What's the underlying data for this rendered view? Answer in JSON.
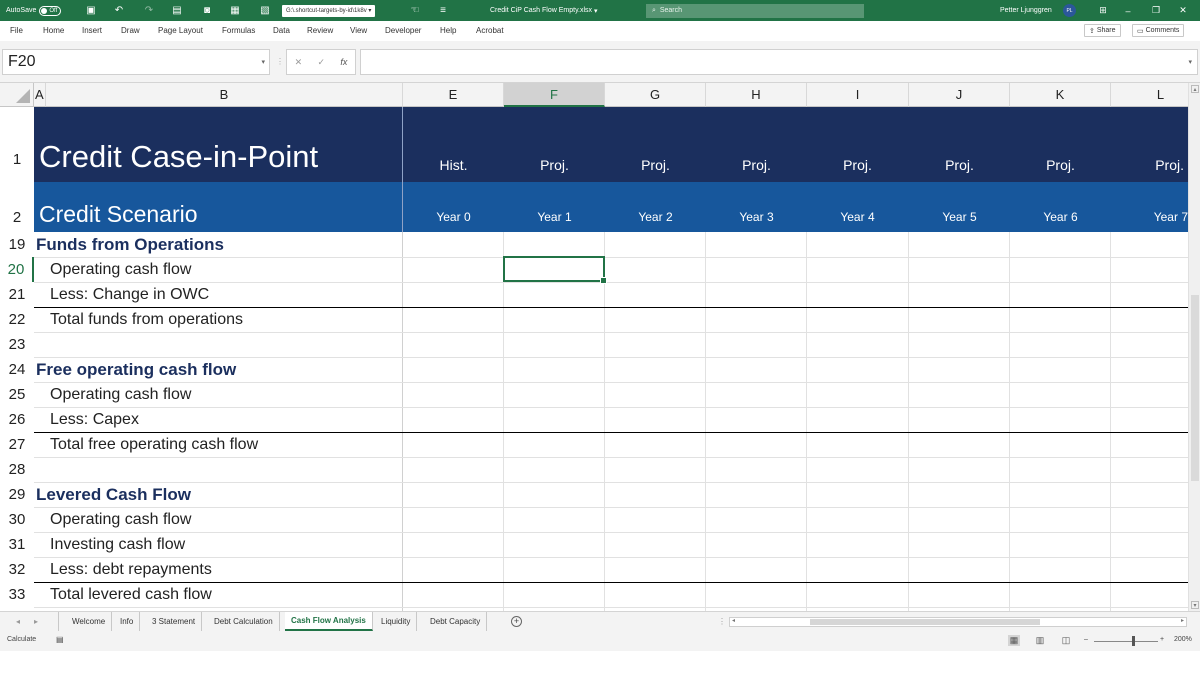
{
  "titlebar": {
    "autosave_label": "AutoSave",
    "autosave_state": "Off",
    "path_label": "G:\\.shortcut-targets-by-id\\1k8v",
    "file_name": "Credit CiP Cash Flow Empty.xlsx",
    "search_placeholder": "Search",
    "user_name": "Petter Ljunggren",
    "user_initials": "PL"
  },
  "ribbon_tabs": [
    "File",
    "Home",
    "Insert",
    "Draw",
    "Page Layout",
    "Formulas",
    "Data",
    "Review",
    "View",
    "Developer",
    "Help",
    "Acrobat"
  ],
  "ribbon_actions": {
    "share_label": "Share",
    "comments_label": "Comments"
  },
  "formula_bar": {
    "name_box": "F20",
    "fx_symbol": "fx",
    "cancel_symbol": "✕",
    "enter_symbol": "✓"
  },
  "columns": [
    {
      "letter": "A"
    },
    {
      "letter": "B"
    },
    {
      "letter": "E"
    },
    {
      "letter": "F"
    },
    {
      "letter": "G"
    },
    {
      "letter": "H"
    },
    {
      "letter": "I"
    },
    {
      "letter": "J"
    },
    {
      "letter": "K"
    },
    {
      "letter": "L"
    }
  ],
  "header_rows": {
    "title": "Credit Case-in-Point",
    "subtitle": "Credit Scenario",
    "row1_num": "1",
    "row2_num": "2",
    "col_types": [
      "Hist.",
      "Proj.",
      "Proj.",
      "Proj.",
      "Proj.",
      "Proj.",
      "Proj.",
      "Proj."
    ],
    "years": [
      "Year 0",
      "Year 1",
      "Year 2",
      "Year 3",
      "Year 4",
      "Year 5",
      "Year 6",
      "Year 7"
    ]
  },
  "rows": [
    {
      "num": "19",
      "label": "Funds from Operations",
      "header": true
    },
    {
      "num": "20",
      "label": "Operating cash flow",
      "header": false
    },
    {
      "num": "21",
      "label": "Less: Change in OWC",
      "header": false
    },
    {
      "num": "22",
      "label": "Total funds from operations",
      "header": false
    },
    {
      "num": "23",
      "label": "",
      "header": false
    },
    {
      "num": "24",
      "label": "Free operating cash flow",
      "header": true
    },
    {
      "num": "25",
      "label": "Operating cash flow",
      "header": false
    },
    {
      "num": "26",
      "label": "Less: Capex",
      "header": false
    },
    {
      "num": "27",
      "label": "Total free operating cash flow",
      "header": false
    },
    {
      "num": "28",
      "label": "",
      "header": false
    },
    {
      "num": "29",
      "label": "Levered Cash Flow",
      "header": true
    },
    {
      "num": "30",
      "label": "Operating cash flow",
      "header": false
    },
    {
      "num": "31",
      "label": "Investing cash flow",
      "header": false
    },
    {
      "num": "32",
      "label": "Less: debt repayments",
      "header": false
    },
    {
      "num": "33",
      "label": "Total levered cash flow",
      "header": false
    }
  ],
  "sheet_tabs": [
    "Welcome",
    "Info",
    "3 Statement",
    "Debt Calculation",
    "Cash Flow Analysis",
    "Liquidity",
    "Debt Capacity"
  ],
  "active_sheet": "Cash Flow Analysis",
  "statusbar": {
    "mode": "Calculate",
    "zoom": "200%"
  },
  "colors": {
    "excel_green": "#217346",
    "band_dark": "#1b2f5e",
    "band_mid": "#17579c"
  }
}
